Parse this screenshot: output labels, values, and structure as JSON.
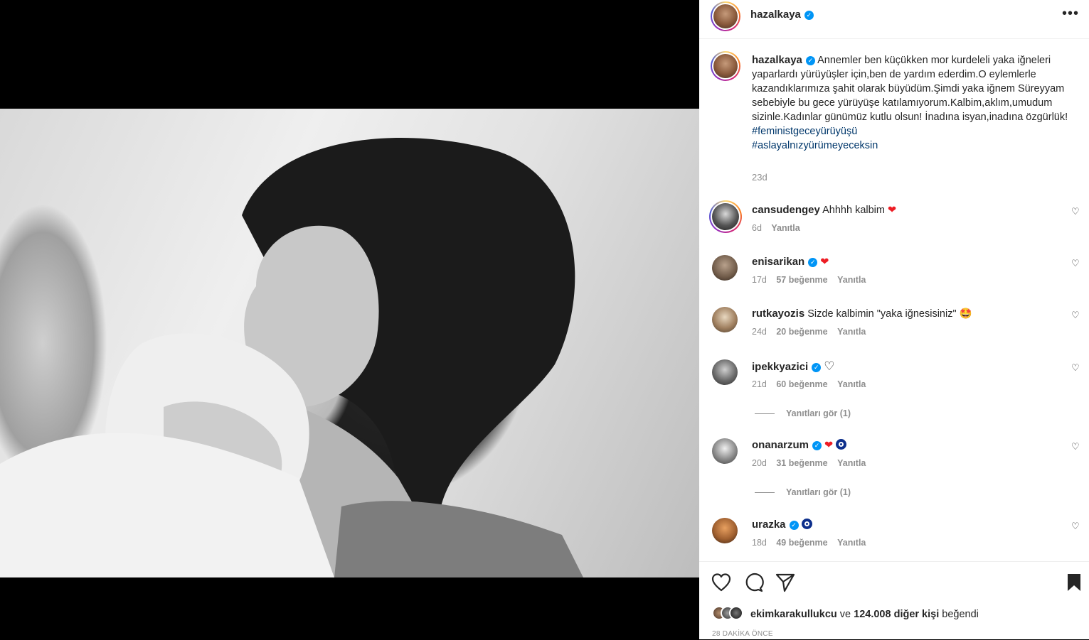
{
  "post": {
    "username": "hazalkaya",
    "caption": "Annemler ben küçükken mor kurdeleli yaka iğneleri yaparlardı yürüyüşler için,ben de yardım ederdim.O eylemlerle kazandıklarımıza şahit olarak büyüdüm.Şimdi yaka iğnem Süreyyam sebebiyle bu gece yürüyüşe katılamıyorum.Kalbim,aklım,umudum sizinle.Kadınlar günümüz kutlu olsun! İnadına isyan,inadına özgürlük!",
    "hashtags": [
      "#feministgeceyürüyüşü",
      "#aslayalnızyürümeyeceksin"
    ],
    "time": "23d",
    "more": "•••"
  },
  "comments": [
    {
      "user": "cansudengey",
      "verified": false,
      "text": "Ahhhh kalbim",
      "emoji": "❤",
      "time": "6d",
      "likes": "",
      "reply": "Yanıtla"
    },
    {
      "user": "enisarikan",
      "verified": true,
      "text": "",
      "emoji": "❤",
      "time": "17d",
      "likes": "57 beğenme",
      "reply": "Yanıtla"
    },
    {
      "user": "rutkayozis",
      "verified": false,
      "text": "Sizde kalbimin \"yaka iğnesisiniz\"",
      "emoji": "🤩",
      "time": "24d",
      "likes": "20 beğenme",
      "reply": "Yanıtla"
    },
    {
      "user": "ipekkyazici",
      "verified": true,
      "text": "",
      "emoji": "♡",
      "time": "21d",
      "likes": "60 beğenme",
      "reply": "Yanıtla",
      "view_replies": "Yanıtları gör (1)"
    },
    {
      "user": "onanarzum",
      "verified": true,
      "text": "",
      "emoji": "❤",
      "time": "20d",
      "likes": "31 beğenme",
      "reply": "Yanıtla",
      "view_replies": "Yanıtları gör (1)"
    },
    {
      "user": "urazka",
      "verified": true,
      "text": "",
      "emoji": "",
      "time": "18d",
      "likes": "49 beğenme",
      "reply": "Yanıtla"
    }
  ],
  "footer": {
    "liked_by_user": "ekimkarakullukcu",
    "liked_by_mid": "ve",
    "liked_by_count": "124.008 diğer kişi",
    "liked_by_suffix": "beğendi",
    "posted": "28 DAKİKA ÖNCE"
  },
  "icons": {
    "like": "heart-outline-icon",
    "comment": "comment-bubble-icon",
    "share": "paper-plane-icon",
    "save": "bookmark-icon"
  },
  "colors": {
    "verified": "#0095f6",
    "hashtag": "#00376b",
    "meta": "#8e8e8e",
    "heart": "#ed1c24"
  }
}
